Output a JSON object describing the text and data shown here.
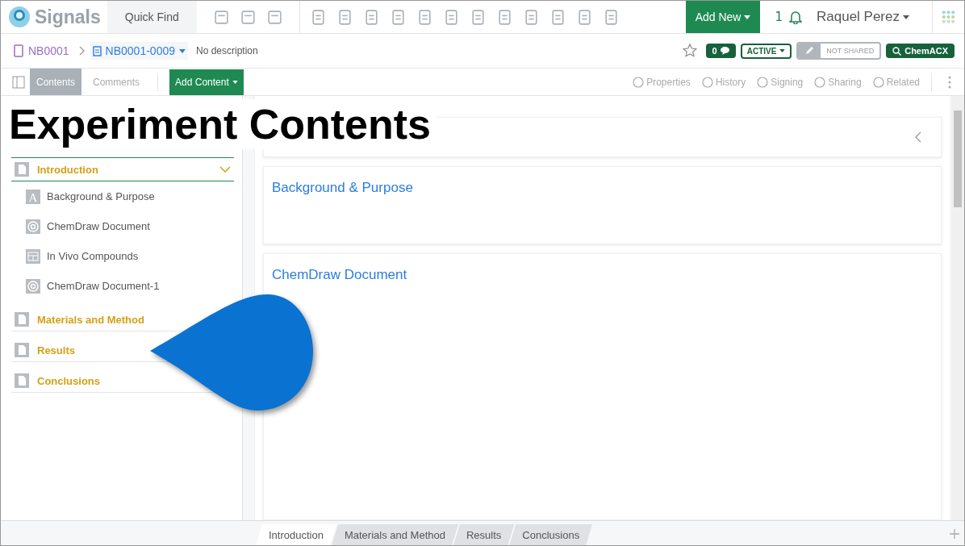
{
  "app": {
    "brand": "Signals",
    "quick_find": "Quick Find",
    "add_new": "Add New",
    "notifications": "1",
    "user": "Raquel Perez"
  },
  "breadcrumb": {
    "notebook": "NB0001",
    "experiment": "NB0001-0009",
    "description": "No description",
    "comments_count": "0",
    "status": "ACTIVE",
    "sharing": "NOT SHARED",
    "search_button": "ChemACX"
  },
  "toolbar": {
    "tabs": [
      {
        "label": "Contents",
        "selected": true
      },
      {
        "label": "Comments",
        "selected": false
      }
    ],
    "add_content": "Add Content",
    "actions": [
      "Properties",
      "History",
      "Signing",
      "Sharing",
      "Related"
    ]
  },
  "overlay_title": "Experiment Contents",
  "outline": [
    {
      "label": "Introduction",
      "expanded": true,
      "children": [
        {
          "label": "Background & Purpose",
          "kind": "text",
          "icon_letter": "A"
        },
        {
          "label": "ChemDraw Document",
          "kind": "chemdraw"
        },
        {
          "label": "In Vivo Compounds",
          "kind": "table"
        },
        {
          "label": "ChemDraw Document-1",
          "kind": "chemdraw"
        }
      ]
    },
    {
      "label": "Materials and Method",
      "expanded": false
    },
    {
      "label": "Results",
      "expanded": false
    },
    {
      "label": "Conclusions",
      "expanded": false
    }
  ],
  "sections": [
    {
      "title": "Background & Purpose"
    },
    {
      "title": "ChemDraw Document"
    }
  ],
  "bottom_tabs": [
    {
      "label": "Introduction",
      "selected": true
    },
    {
      "label": "Materials and Method",
      "selected": false
    },
    {
      "label": "Results",
      "selected": false
    },
    {
      "label": "Conclusions",
      "selected": false
    }
  ]
}
